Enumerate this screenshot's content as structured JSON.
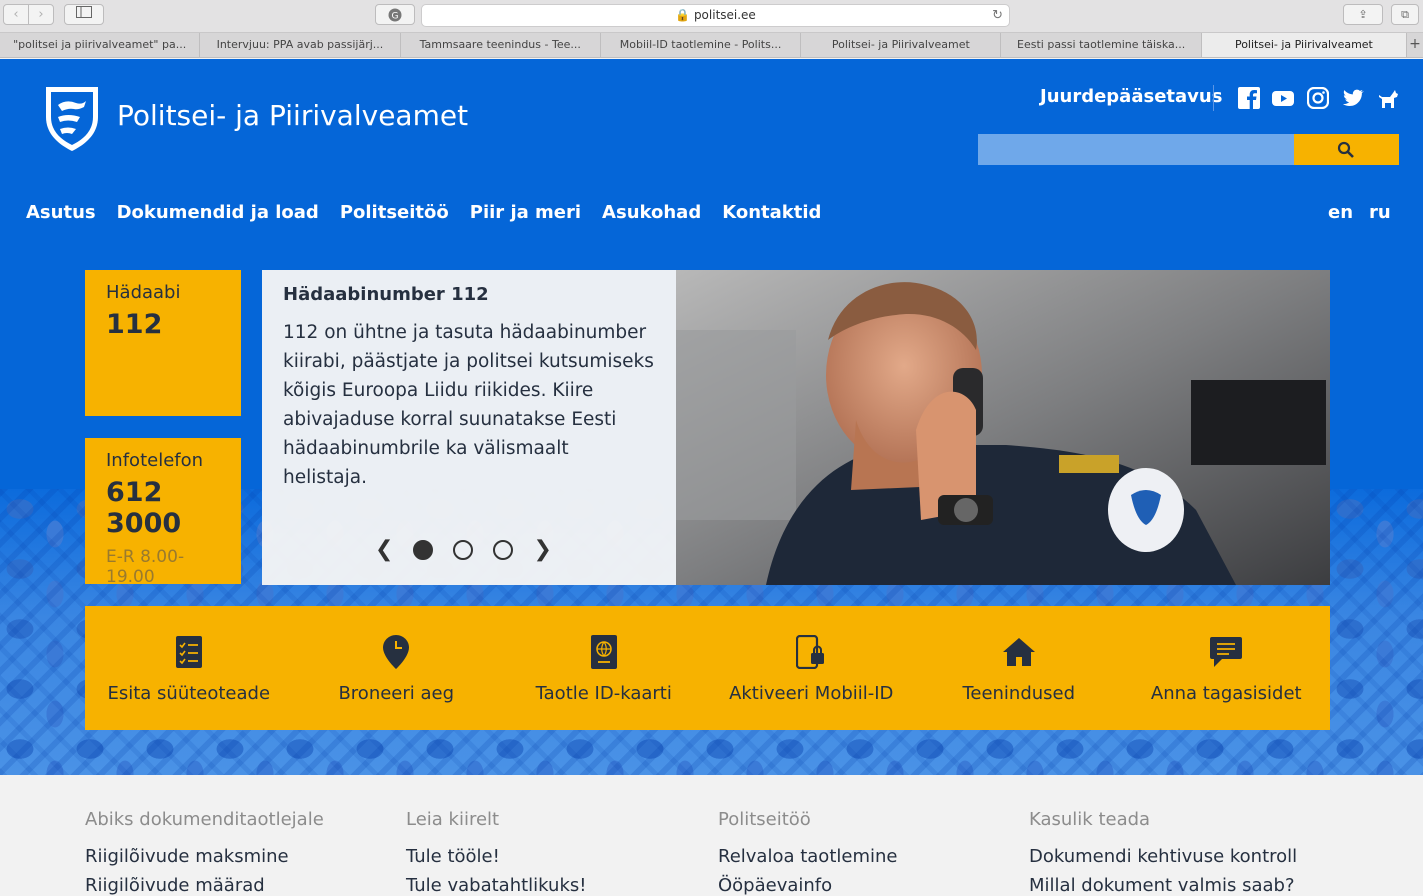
{
  "browser": {
    "url": "politsei.ee",
    "tabs": [
      {
        "label": "\"politsei ja piirivalveamet\" pa..."
      },
      {
        "label": "Intervjuu: PPA avab passijärj..."
      },
      {
        "label": "Tammsaare teenindus - Tee..."
      },
      {
        "label": "Mobiil-ID taotlemine - Polits..."
      },
      {
        "label": "Politsei- ja Piirivalveamet"
      },
      {
        "label": "Eesti passi taotlemine täiska..."
      },
      {
        "label": "Politsei- ja Piirivalveamet"
      }
    ],
    "new_tab": "+"
  },
  "header": {
    "title": "Politsei- ja Piirivalveamet",
    "accessibility": "Juurdepääsetavus",
    "social": [
      "facebook-icon",
      "youtube-icon",
      "instagram-icon",
      "twitter-icon",
      "dog-icon"
    ],
    "search_placeholder": ""
  },
  "nav": {
    "items": [
      "Asutus",
      "Dokumendid ja load",
      "Politseitöö",
      "Piir ja meri",
      "Asukohad",
      "Kontaktid"
    ],
    "lang_en": "en",
    "lang_ru": "ru"
  },
  "emergency": {
    "label": "Hädaabi",
    "number": "112"
  },
  "info": {
    "label": "Infotelefon",
    "number": "612 3000",
    "hours": "E-R 8.00-19.00"
  },
  "slide": {
    "title": "Hädaabinumber 112",
    "text": "112 on ühtne ja tasuta hädaabinumber kiirabi, päästjate ja politsei kutsumiseks kõigis Euroopa Liidu riikides. Kiire abivajaduse korral suunatakse Eesti hädaabinumbrile ka välismaalt helistaja.",
    "active_index": 1,
    "total": 3
  },
  "quick": [
    {
      "label": "Esita süüteoteade",
      "icon": "checklist-icon"
    },
    {
      "label": "Broneeri aeg",
      "icon": "location-clock-icon"
    },
    {
      "label": "Taotle ID-kaarti",
      "icon": "passport-icon"
    },
    {
      "label": "Aktiveeri Mobiil-ID",
      "icon": "phone-lock-icon"
    },
    {
      "label": "Teenindused",
      "icon": "home-icon"
    },
    {
      "label": "Anna tagasisidet",
      "icon": "chat-icon"
    }
  ],
  "footer": [
    {
      "heading": "Abiks dokumenditaotlejale",
      "links": [
        "Riigilõivude maksmine",
        "Riigilõivude määrad"
      ]
    },
    {
      "heading": "Leia kiirelt",
      "links": [
        "Tule tööle!",
        "Tule vabatahtlikuks!"
      ]
    },
    {
      "heading": "Politseitöö",
      "links": [
        "Relvaloa taotlemine",
        "Ööpäevainfo"
      ]
    },
    {
      "heading": "Kasulik teada",
      "links": [
        "Dokumendi kehtivuse kontroll",
        "Millal dokument valmis saab?"
      ]
    }
  ],
  "colors": {
    "brand_blue": "#0566d8",
    "accent_yellow": "#f7b200",
    "text_dark": "#263040"
  }
}
